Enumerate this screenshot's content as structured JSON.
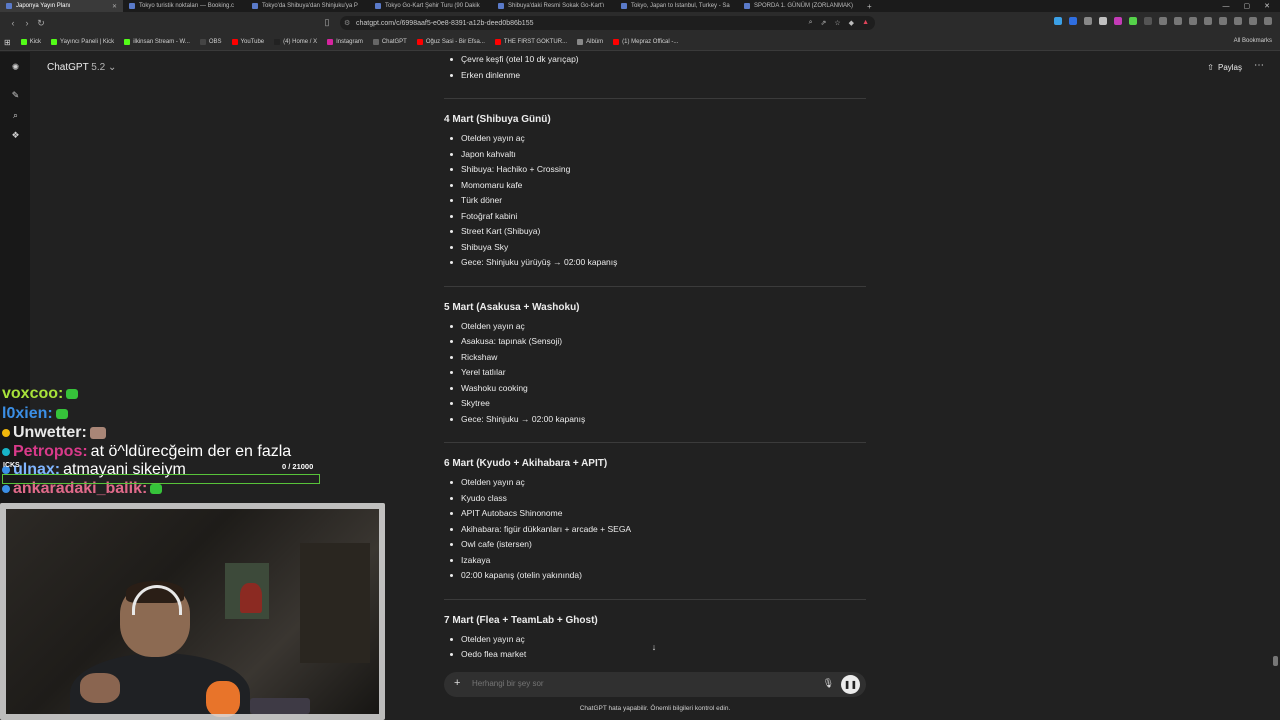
{
  "browser": {
    "tabs": [
      {
        "label": "Japonya Yayın Planı",
        "active": true
      },
      {
        "label": "Tokyo turistik noktaları — Booking.c"
      },
      {
        "label": "Tokyo'da Shibuya'dan Shinjuku'ya P"
      },
      {
        "label": "Tokyo Go-Kart Şehir Turu (90 Dakik"
      },
      {
        "label": "Shibuya'daki Resmi Sokak Go-Kart'ı"
      },
      {
        "label": "Tokyo, Japan to Istanbul, Turkey - Sa"
      },
      {
        "label": "SPORDA 1. GÜNÜM (ZORLANMAK)"
      }
    ],
    "url": "chatgpt.com/c/6998aaf5-e0e8-8391-a12b-deed0b86b155",
    "bookmarks": [
      "Kick",
      "Yayıncı Paneli | Kick",
      "ilkinsan Stream - W...",
      "OBS",
      "YouTube",
      "(4) Home / X",
      "Instagram",
      "ChatGPT",
      "Oğuz Sasi - Bir Efsa...",
      "THE FIRST GOKTUR...",
      "Albüm",
      "(1) Mepraz Offical -..."
    ],
    "all_bookmarks": "All Bookmarks"
  },
  "header": {
    "model": "ChatGPT",
    "version": "5.2",
    "share": "Paylaş"
  },
  "intro_items": [
    "Çevre keşfi (otel 10 dk yarıçap)",
    "Erken dinlenme"
  ],
  "days": [
    {
      "title": "4 Mart (Shibuya Günü)",
      "items": [
        "Otelden yayın aç",
        "Japon kahvaltı",
        "Shibuya: Hachiko + Crossing",
        "Momomaru kafe",
        "Türk döner",
        "Fotoğraf kabini",
        "Street Kart (Shibuya)",
        "Shibuya Sky",
        "Gece: Shinjuku yürüyüş → 02:00 kapanış"
      ]
    },
    {
      "title": "5 Mart (Asakusa + Washoku)",
      "items": [
        "Otelden yayın aç",
        "Asakusa: tapınak (Sensoji)",
        "Rickshaw",
        "Yerel tatlılar",
        "Washoku cooking",
        "Skytree",
        "Gece: Shinjuku → 02:00 kapanış"
      ]
    },
    {
      "title": "6 Mart (Kyudo + Akihabara + APIT)",
      "items": [
        "Otelden yayın aç",
        "Kyudo class",
        "APIT Autobacs Shinonome",
        "Akihabara: figür dükkanları + arcade + SEGA",
        "Owl cafe (istersen)",
        "Izakaya",
        "02:00 kapanış (otelin yakınında)"
      ]
    },
    {
      "title": "7 Mart (Flea + TeamLab + Ghost)",
      "items": [
        "Otelden yayın aç",
        "Oedo flea market"
      ]
    }
  ],
  "composer": {
    "placeholder": "Herhangi bir şey sor"
  },
  "disclaimer": "ChatGPT hata yapabilir. Önemli bilgileri kontrol edin.",
  "stream_chat": {
    "messages": [
      {
        "user": "voxcoo:",
        "text": "",
        "color": "#a8e23a"
      },
      {
        "user": "l0xien:",
        "text": "",
        "color": "#3b8fe6"
      },
      {
        "user": "Unwetter:",
        "text": "",
        "color": "#e9e9e9"
      },
      {
        "user": "Petropos:",
        "text": "at ö^ldürecğeim der en fazla",
        "color": "#d93a8a"
      },
      {
        "user": "ulnax:",
        "text": "atmayani sikeiym",
        "color": "#7fb5ff"
      },
      {
        "user": "ankaradaki_balik:",
        "text": "",
        "color": "#e06a8a"
      }
    ],
    "overlay_text": "ICKS",
    "counter": "0 / 21000"
  }
}
